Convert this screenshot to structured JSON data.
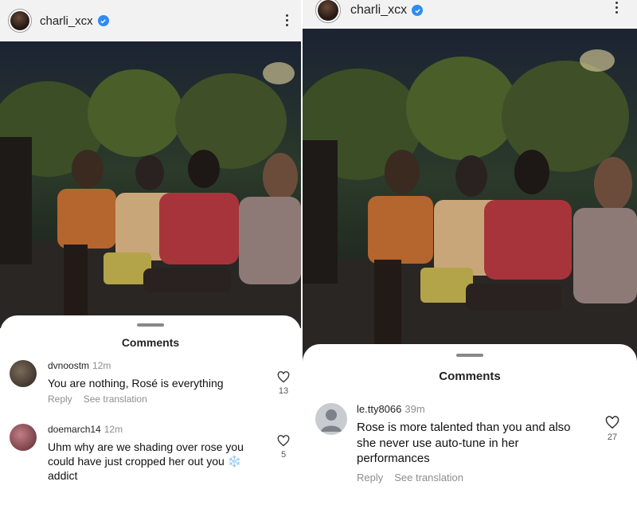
{
  "left": {
    "username": "charli_xcx",
    "sheet_title": "Comments",
    "comments": [
      {
        "user": "dvnoostm",
        "time": "12m",
        "text": "You are nothing, Rosé is everything",
        "reply": "Reply",
        "translate": "See translation",
        "likes": "13"
      },
      {
        "user": "doemarch14",
        "time": "12m",
        "text": "Uhm why are we shading over rose you could have just cropped her out you ❄️ addict",
        "likes": "5"
      }
    ]
  },
  "right": {
    "username": "charli_xcx",
    "sheet_title": "Comments",
    "comments": [
      {
        "user": "le.tty8066",
        "time": "39m",
        "text": "Rose is more talented than you and also she never use auto-tune in her performances",
        "reply": "Reply",
        "translate": "See translation",
        "likes": "27"
      }
    ]
  },
  "colors": {
    "verified": "#2d8cf0",
    "meta_gray": "#8e8e8e",
    "topbar": "#f2f2f2"
  },
  "icons": [
    "verified-badge-icon",
    "more-options-icon",
    "heart-icon",
    "default-avatar-icon"
  ]
}
